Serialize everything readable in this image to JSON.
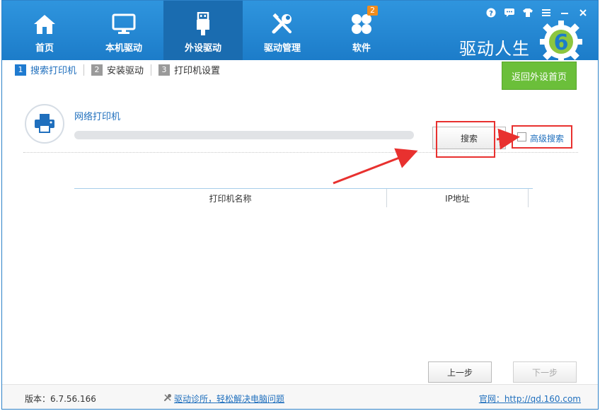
{
  "nav": {
    "items": [
      {
        "label": "首页",
        "icon": "home-icon"
      },
      {
        "label": "本机驱动",
        "icon": "monitor-icon"
      },
      {
        "label": "外设驱动",
        "icon": "usb-icon"
      },
      {
        "label": "驱动管理",
        "icon": "tools-icon"
      },
      {
        "label": "软件",
        "icon": "apps-icon",
        "badge": "2"
      }
    ],
    "active": "外设驱动"
  },
  "window_controls": [
    "help-icon",
    "chat-icon",
    "skin-icon",
    "menu-icon",
    "minimize-icon",
    "close-icon"
  ],
  "brand": {
    "name": "驱动人生",
    "logo_digit": "6"
  },
  "steps": [
    {
      "num": "1",
      "label": "搜索打印机",
      "active": true
    },
    {
      "num": "2",
      "label": "安装驱动",
      "active": false
    },
    {
      "num": "3",
      "label": "打印机设置",
      "active": false
    }
  ],
  "back_button": "返回外设首页",
  "search": {
    "title": "网络打印机",
    "progress": 0,
    "search_button": "搜索",
    "advanced_label": "高级搜索",
    "advanced_checked": false
  },
  "table": {
    "columns": [
      "打印机名称",
      "IP地址"
    ],
    "rows": []
  },
  "buttons": {
    "prev": "上一步",
    "next": "下一步"
  },
  "footer": {
    "version": "版本：6.7.56.166",
    "diagnose_link": "驱动诊所，轻松解决电脑问题",
    "site": "官网：http://qd.160.com"
  },
  "colors": {
    "topbar": "#1c7cc9",
    "accent": "#1f6fbd",
    "back_button": "#6bbf3a",
    "highlight": "#e8312f",
    "badge": "#f08c1d"
  }
}
